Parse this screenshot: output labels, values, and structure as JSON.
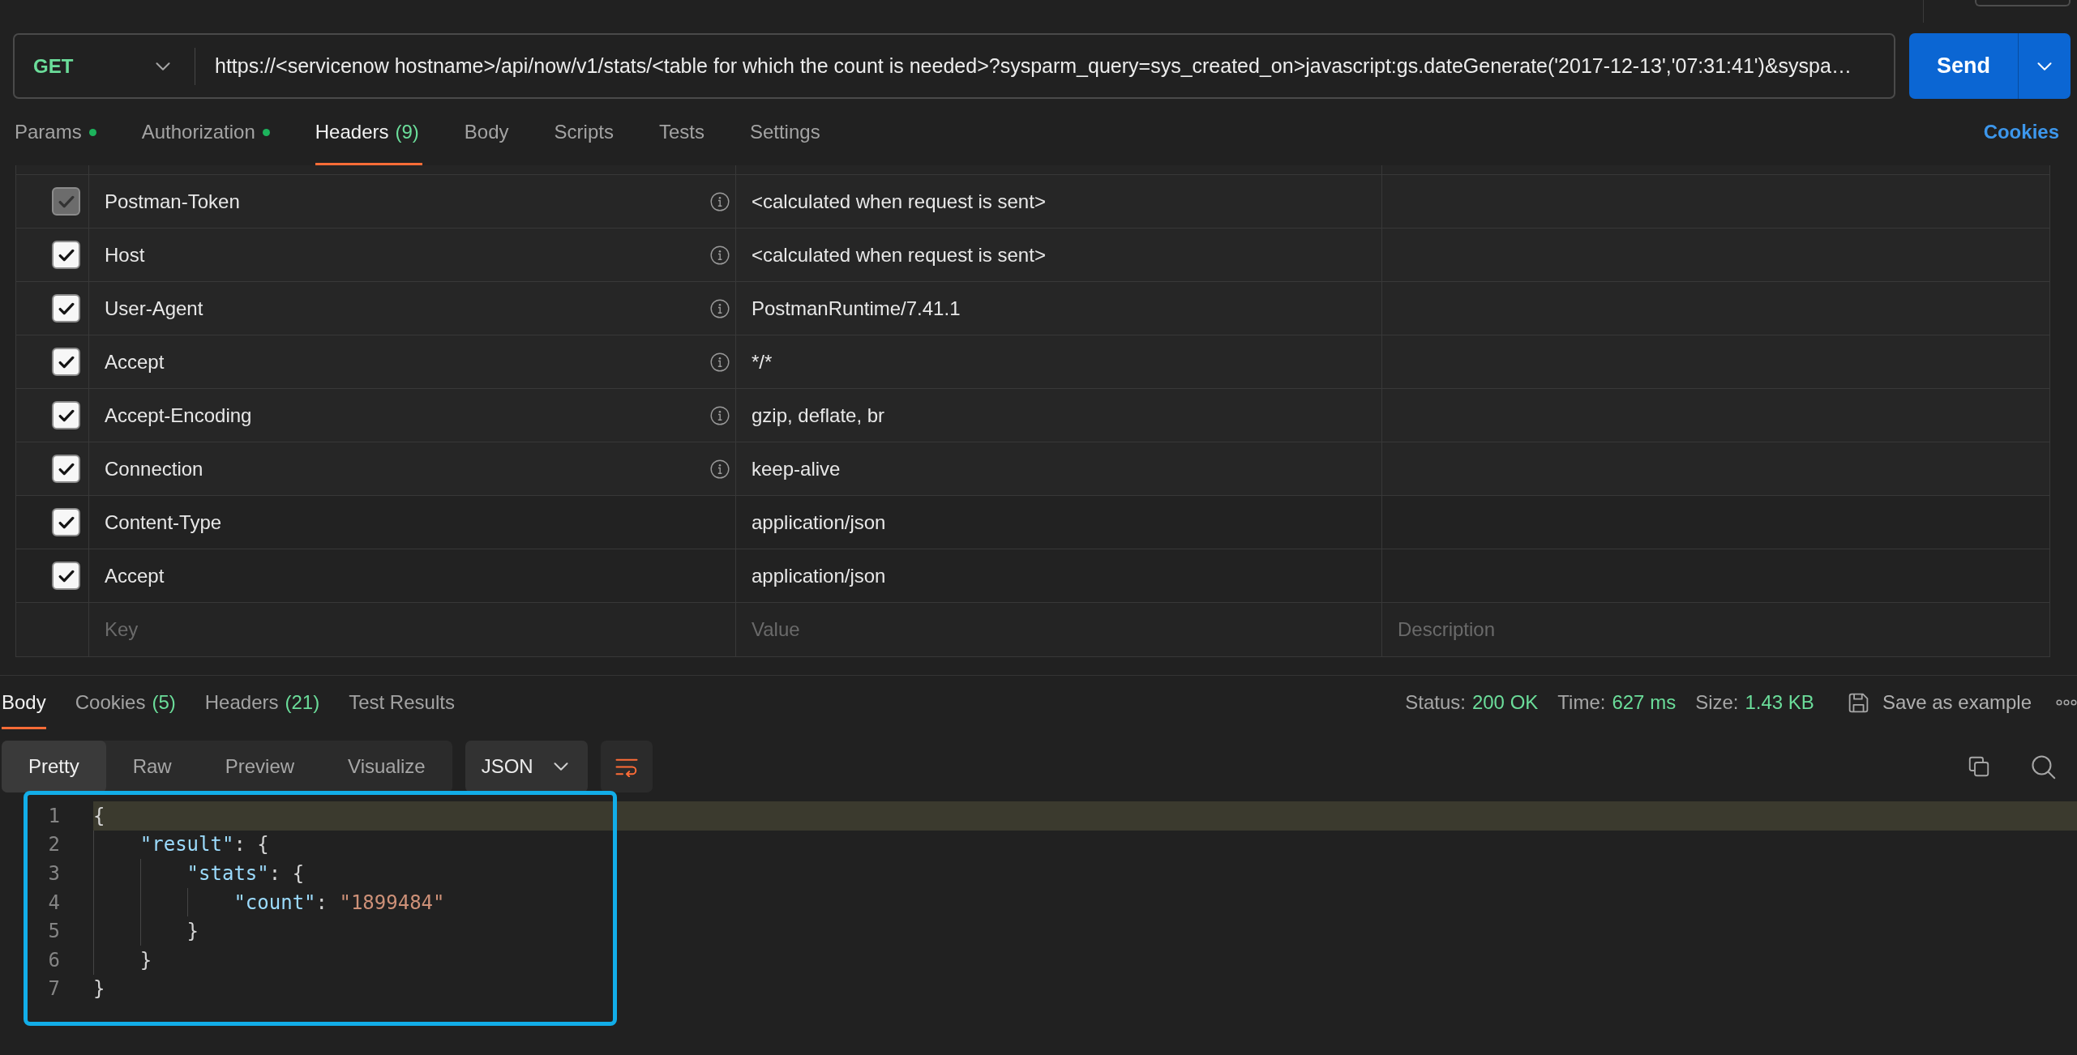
{
  "request": {
    "method": "GET",
    "url": "https://<servicenow hostname>/api/now/v1/stats/<table for which the count is needed>?sysparm_query=sys_created_on>javascript:gs.dateGenerate('2017-12-13','07:31:41')&syspa…",
    "send": "Send"
  },
  "tabs": [
    {
      "label": "Params",
      "dot": true,
      "selected": false
    },
    {
      "label": "Authorization",
      "dot": true,
      "selected": false
    },
    {
      "label": "Headers",
      "count": "(9)",
      "dot": false,
      "selected": true
    },
    {
      "label": "Body",
      "dot": false,
      "selected": false
    },
    {
      "label": "Scripts",
      "dot": false,
      "selected": false
    },
    {
      "label": "Tests",
      "dot": false,
      "selected": false
    },
    {
      "label": "Settings",
      "dot": false,
      "selected": false
    }
  ],
  "cookies_link": "Cookies",
  "headers_table": {
    "rows": [
      {
        "key": "Postman-Token",
        "value": "<calculated when request is sent>",
        "kind": "auto",
        "checked": true,
        "disabled": true
      },
      {
        "key": "Host",
        "value": "<calculated when request is sent>",
        "kind": "auto",
        "checked": true,
        "disabled": false
      },
      {
        "key": "User-Agent",
        "value": "PostmanRuntime/7.41.1",
        "kind": "auto",
        "checked": true,
        "disabled": false
      },
      {
        "key": "Accept",
        "value": "*/*",
        "kind": "auto",
        "checked": true,
        "disabled": false
      },
      {
        "key": "Accept-Encoding",
        "value": "gzip, deflate, br",
        "kind": "auto",
        "checked": true,
        "disabled": false
      },
      {
        "key": "Connection",
        "value": "keep-alive",
        "kind": "auto",
        "checked": true,
        "disabled": false
      },
      {
        "key": "Content-Type",
        "value": "application/json",
        "kind": "custom",
        "checked": true,
        "disabled": false
      },
      {
        "key": "Accept",
        "value": "application/json",
        "kind": "custom",
        "checked": true,
        "disabled": false
      }
    ],
    "new_row": {
      "key_placeholder": "Key",
      "value_placeholder": "Value",
      "description_placeholder": "Description"
    }
  },
  "response": {
    "tabs": [
      {
        "label": "Body",
        "selected": true
      },
      {
        "label": "Cookies",
        "count": "(5)",
        "selected": false
      },
      {
        "label": "Headers",
        "count": "(21)",
        "selected": false
      },
      {
        "label": "Test Results",
        "selected": false
      }
    ],
    "stats": [
      {
        "label": "Status:",
        "value": "200 OK"
      },
      {
        "label": "Time:",
        "value": "627 ms"
      },
      {
        "label": "Size:",
        "value": "1.43 KB"
      }
    ],
    "save_example": "Save as example",
    "views": [
      {
        "label": "Pretty",
        "selected": true
      },
      {
        "label": "Raw",
        "selected": false
      },
      {
        "label": "Preview",
        "selected": false
      },
      {
        "label": "Visualize",
        "selected": false
      }
    ],
    "format": "JSON",
    "wrap": {
      "on": true
    },
    "code": {
      "lines": [
        {
          "number": "1",
          "highlighted": true,
          "tokens": [
            {
              "kind": "punct",
              "text": "{"
            }
          ],
          "children": [
            {
              "number": "2",
              "highlighted": false,
              "tokens": [
                {
                  "kind": "key",
                  "text": "\"result\""
                },
                {
                  "kind": "punct",
                  "text": ": {"
                }
              ],
              "children": [
                {
                  "number": "3",
                  "highlighted": false,
                  "tokens": [
                    {
                      "kind": "key",
                      "text": "\"stats\""
                    },
                    {
                      "kind": "punct",
                      "text": ": {"
                    }
                  ],
                  "children": [
                    {
                      "number": "4",
                      "highlighted": false,
                      "tokens": [
                        {
                          "kind": "key",
                          "text": "\"count\""
                        },
                        {
                          "kind": "punct",
                          "text": ": "
                        },
                        {
                          "kind": "string",
                          "text": "\"1899484\""
                        }
                      ]
                    }
                  ]
                },
                {
                  "number": "5",
                  "highlighted": false,
                  "tokens": [
                    {
                      "kind": "punct",
                      "text": "}"
                    }
                  ]
                }
              ]
            },
            {
              "number": "6",
              "highlighted": false,
              "tokens": [
                {
                  "kind": "punct",
                  "text": "}"
                }
              ]
            }
          ]
        },
        {
          "number": "7",
          "highlighted": false,
          "tokens": [
            {
              "kind": "punct",
              "text": "}"
            }
          ]
        }
      ]
    }
  }
}
